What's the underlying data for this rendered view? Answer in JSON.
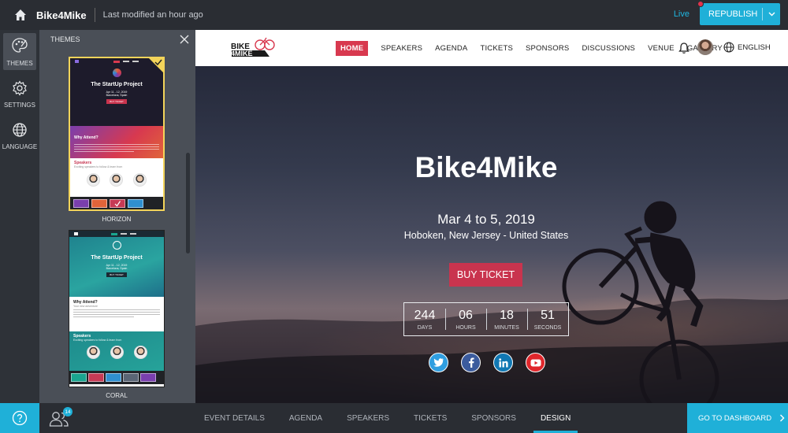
{
  "app": {
    "title": "Bike4Mike",
    "modified": "Last modified an hour ago",
    "live_label": "Live",
    "republish_label": "REPUBLISH"
  },
  "rail": {
    "items": [
      {
        "label": "THEMES",
        "icon": "palette-icon"
      },
      {
        "label": "SETTINGS",
        "icon": "gear-icon"
      },
      {
        "label": "LANGUAGE",
        "icon": "globe-icon"
      }
    ]
  },
  "themes_panel": {
    "header": "THEMES",
    "themes": [
      {
        "name": "HORIZON",
        "selected": true,
        "mini_title": "The StartUp Project",
        "mini_date": "Apr 11 - 12, 2019",
        "mini_place": "Barcelona, Spain",
        "mini_btn": "BUY TICKET",
        "why": "Why Attend?",
        "speakers": "Speakers",
        "speakers_sub": "Exciting speakers to follow & learn from",
        "swatches": [
          "#7a3fae",
          "#e0643a",
          "#c73a55",
          "#2f8fd0"
        ]
      },
      {
        "name": "CORAL",
        "selected": false,
        "mini_title": "The StartUp Project",
        "mini_date": "Apr 11 - 12, 2019",
        "mini_place": "Barcelona, Spain",
        "mini_btn": "BUY TICKET",
        "why": "Why Attend?",
        "why_sub": "Your new adventure",
        "speakers": "Speakers",
        "speakers_sub": "Exciting speakers to follow & learn from",
        "swatches": [
          "#1aa58f",
          "#c73a55",
          "#2f8fd0",
          "#5a6575",
          "#7a3fae"
        ]
      }
    ]
  },
  "site": {
    "nav": [
      "HOME",
      "SPEAKERS",
      "AGENDA",
      "TICKETS",
      "SPONSORS",
      "DISCUSSIONS",
      "VENUE",
      "GALLERY"
    ],
    "language": "ENGLISH",
    "logo_line1": "BIKE",
    "logo_line2": "4MIKE",
    "hero_title": "Bike4Mike",
    "hero_date": "Mar 4 to 5, 2019",
    "hero_location": "Hoboken, New Jersey - United States",
    "buy_label": "BUY TICKET",
    "countdown": [
      {
        "value": "244",
        "label": "DAYS"
      },
      {
        "value": "06",
        "label": "HOURS"
      },
      {
        "value": "18",
        "label": "MINUTES"
      },
      {
        "value": "51",
        "label": "SECONDS"
      }
    ],
    "socials": [
      {
        "name": "twitter",
        "glyph": "🐦",
        "color": "#2f9ee0"
      },
      {
        "name": "facebook",
        "glyph": "f",
        "color": "#3b5b9d"
      },
      {
        "name": "linkedin",
        "glyph": "in",
        "color": "#1178b3"
      },
      {
        "name": "youtube",
        "glyph": "▶",
        "color": "#e0262b"
      }
    ]
  },
  "bottom": {
    "people_count": "14",
    "tabs": [
      "EVENT DETAILS",
      "AGENDA",
      "SPEAKERS",
      "TICKETS",
      "SPONSORS",
      "DESIGN"
    ],
    "active_tab": "DESIGN",
    "goto_label": "GO TO DASHBOARD"
  },
  "colors": {
    "accent": "#1fb0d8",
    "brand_red": "#d8394f"
  }
}
